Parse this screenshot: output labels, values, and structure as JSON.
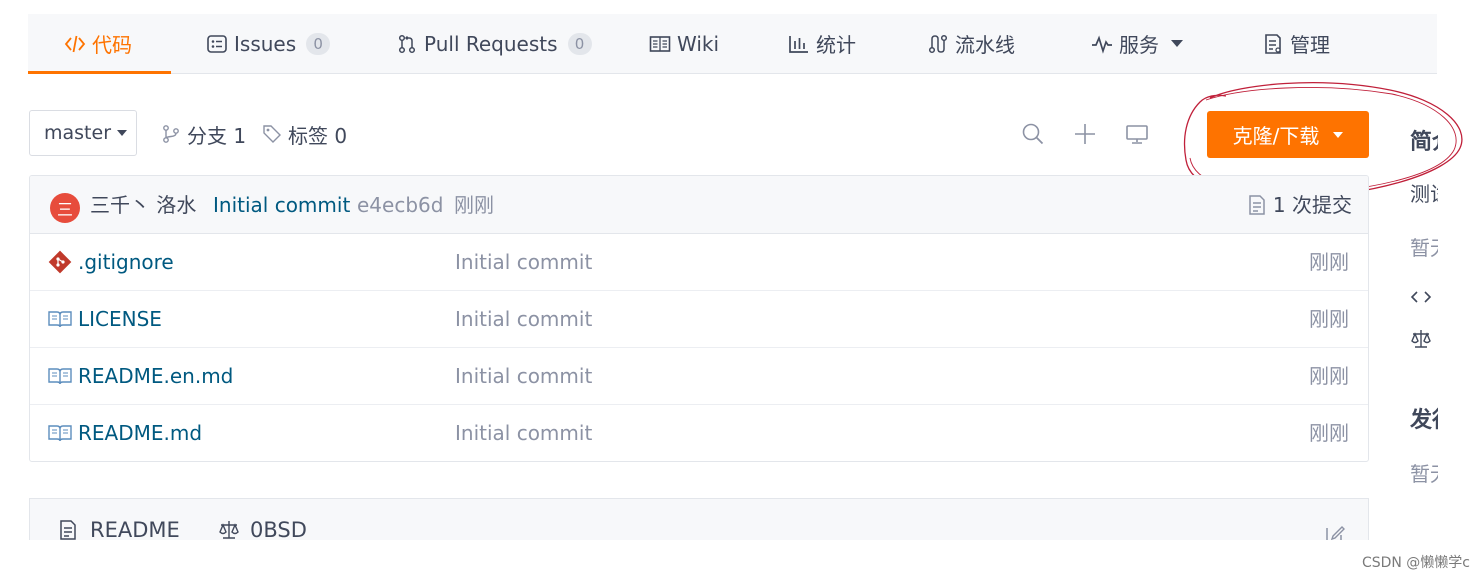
{
  "tabs": [
    {
      "label": "代码",
      "icon": "code-icon",
      "active": true
    },
    {
      "label": "Issues",
      "icon": "issues-icon",
      "count": "0"
    },
    {
      "label": "Pull Requests",
      "icon": "pull-request-icon",
      "count": "0"
    },
    {
      "label": "Wiki",
      "icon": "wiki-icon"
    },
    {
      "label": "统计",
      "icon": "chart-icon"
    },
    {
      "label": "流水线",
      "icon": "pipeline-icon"
    },
    {
      "label": "服务",
      "icon": "pulse-icon",
      "dropdown": true
    },
    {
      "label": "管理",
      "icon": "manage-icon"
    }
  ],
  "toolbar": {
    "branch": "master",
    "branches_label": "分支 1",
    "tags_label": "标签 0",
    "clone_label": "克隆/下载"
  },
  "last_commit": {
    "avatar_text": "三",
    "author": "三千丶 洛水",
    "message": "Initial commit",
    "sha": "e4ecb6d",
    "time": "刚刚",
    "commit_count": "1 次提交"
  },
  "files": [
    {
      "name": ".gitignore",
      "icon": "git-file-icon",
      "message": "Initial commit",
      "time": "刚刚"
    },
    {
      "name": "LICENSE",
      "icon": "book-icon",
      "message": "Initial commit",
      "time": "刚刚"
    },
    {
      "name": "README.en.md",
      "icon": "book-icon",
      "message": "Initial commit",
      "time": "刚刚"
    },
    {
      "name": "README.md",
      "icon": "book-icon",
      "message": "Initial commit",
      "time": "刚刚"
    }
  ],
  "readme": {
    "readme_tab": "README",
    "license_tab": "0BSD"
  },
  "sidebar": {
    "intro_heading": "简介",
    "intro_text": "测试",
    "intro_empty": "暂无",
    "release_heading": "发行版",
    "release_empty": "暂无"
  },
  "colors": {
    "accent": "#fe7300",
    "link": "#005980",
    "muted": "#8c92a4",
    "annotation": "#c0203a"
  },
  "watermark": "CSDN @懒懒学c"
}
